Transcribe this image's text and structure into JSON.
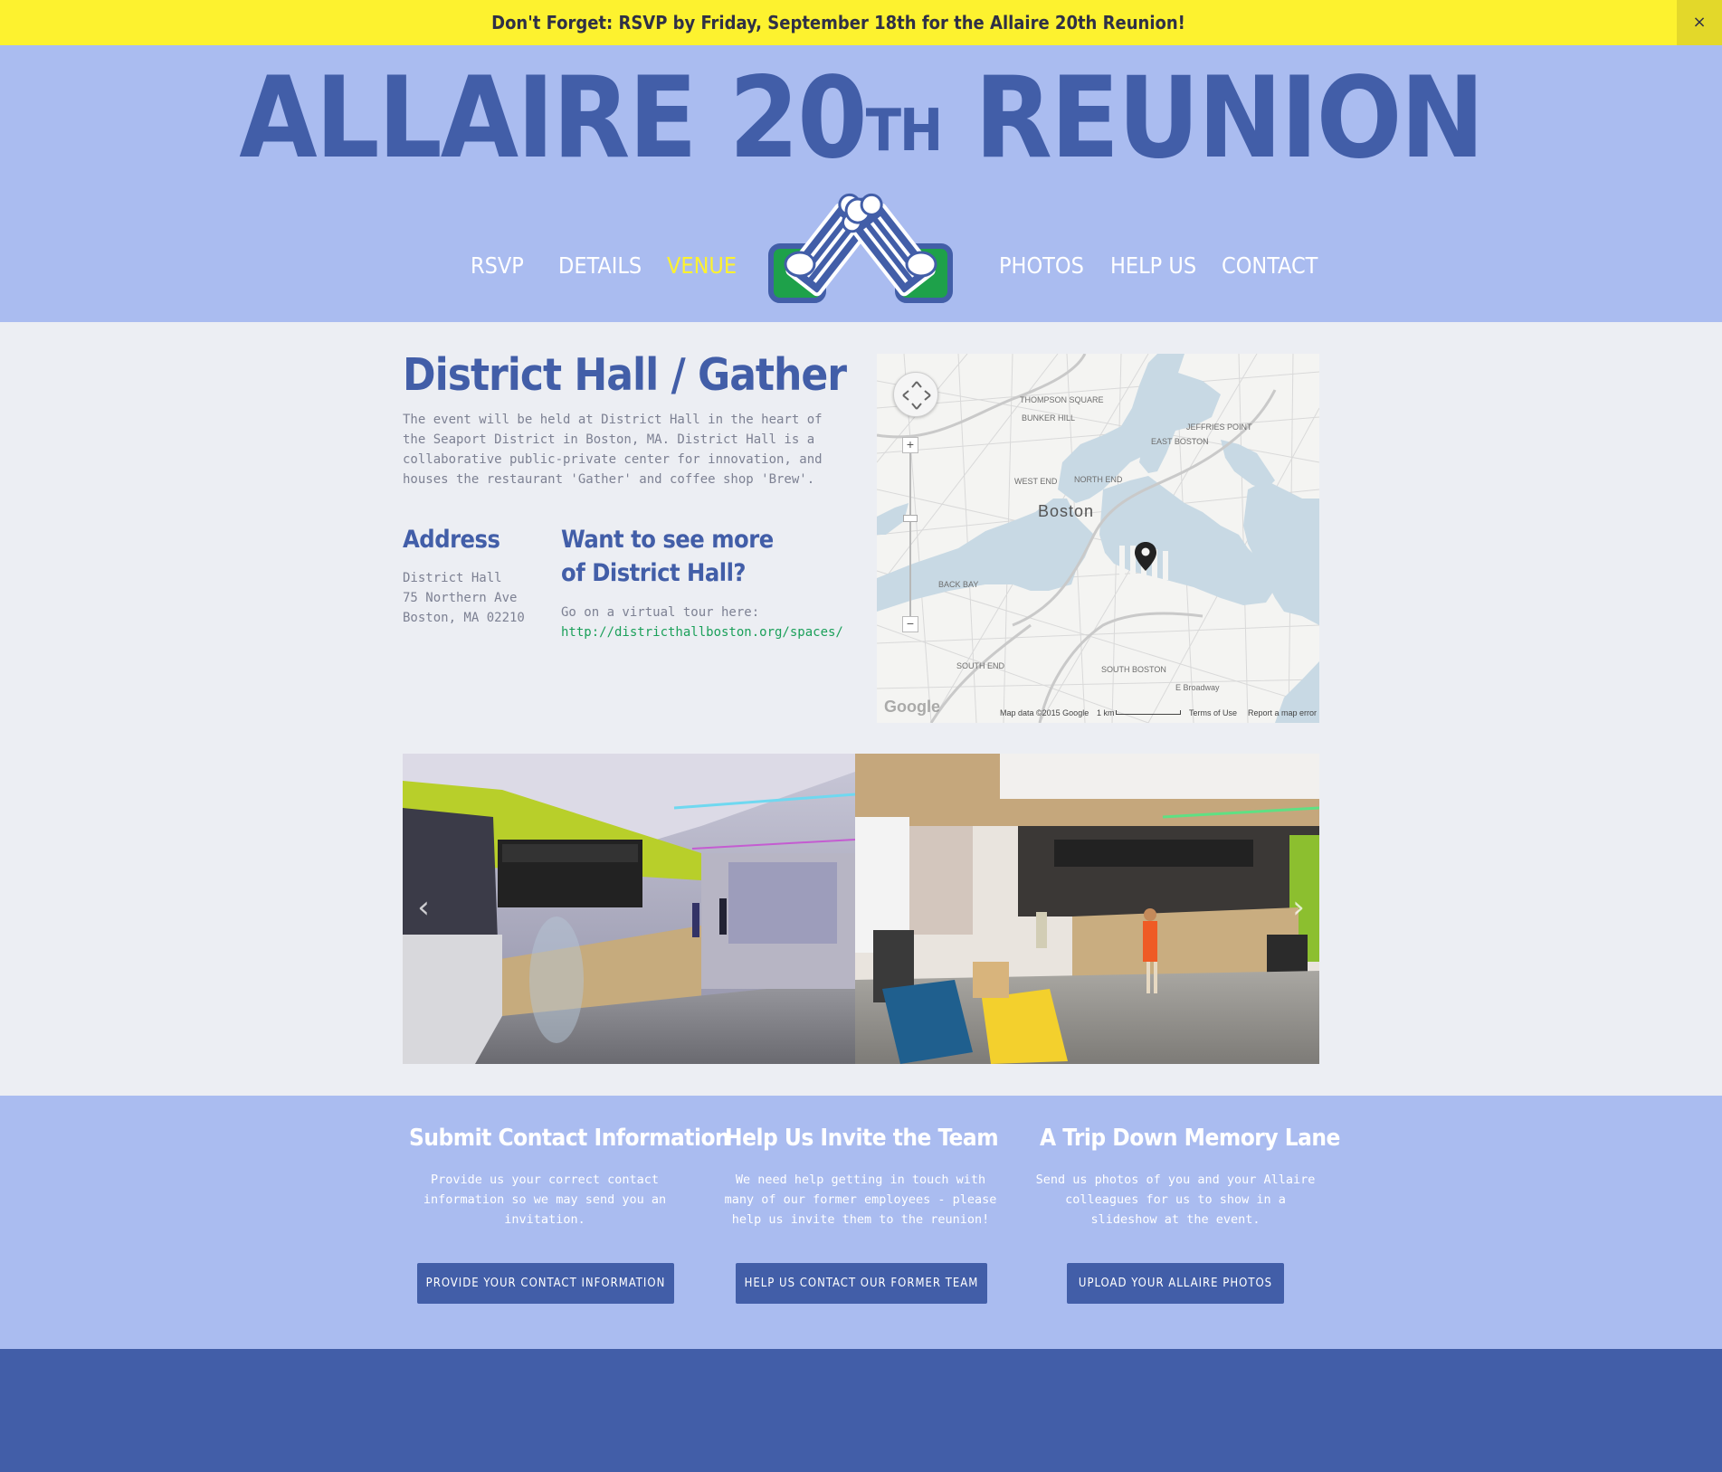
{
  "alert": {
    "text": "Don't Forget: RSVP by Friday, September 18th for the Allaire 20th Reunion!",
    "close_icon": "×"
  },
  "header": {
    "title_main": "ALLAIRE 20",
    "title_sup": "TH",
    "title_end": " REUNION",
    "logo_icon": "crossed-beer-mugs-logo"
  },
  "nav": {
    "items": [
      {
        "label": "RSVP"
      },
      {
        "label": "DETAILS"
      },
      {
        "label": "VENUE"
      },
      {
        "label": "PHOTOS"
      },
      {
        "label": "HELP US"
      },
      {
        "label": "CONTACT"
      }
    ],
    "active": "VENUE"
  },
  "venue": {
    "title": "District Hall / Gather",
    "description": "The event will be held at District Hall in the heart of the Seaport District in Boston, MA.  District Hall is a collaborative public-private center for innovation, and houses the restaurant 'Gather' and coffee shop 'Brew'.",
    "address": {
      "heading": "Address",
      "lines": [
        "District Hall",
        "75 Northern Ave",
        "Boston, MA 02210"
      ]
    },
    "tour": {
      "heading_line1": "Want to see more",
      "heading_line2": "of District Hall?",
      "text": "Go on a virtual tour here:",
      "link": "http://districthallboston.org/spaces/"
    }
  },
  "map": {
    "labels": {
      "thompson": "THOMPSON SQUARE",
      "bunker": "BUNKER HILL",
      "jeffries": "JEFFRIES POINT",
      "east_boston": "EAST BOSTON",
      "west_end": "WEST END",
      "north_end": "NORTH END",
      "boston": "Boston",
      "back_bay": "BACK BAY",
      "south_end": "SOUTH END",
      "south_boston": "SOUTH BOSTON",
      "e_broadway": "E Broadway"
    },
    "footer": {
      "data": "Map data ©2015 Google",
      "scale": "1 km",
      "terms": "Terms of Use",
      "report": "Report a map error"
    },
    "zoom_in": "+",
    "zoom_out": "−",
    "brand": "Google"
  },
  "carousel": {
    "prev_icon": "‹",
    "next_icon": "›"
  },
  "cta": [
    {
      "title": "Submit Contact Information",
      "text": "Provide us your correct contact information so we may send you an invitation.",
      "button": "PROVIDE YOUR CONTACT INFORMATION"
    },
    {
      "title": "Help Us Invite the Team",
      "text": "We need help getting in touch with many of our former employees - please help us invite them to the reunion!",
      "button": "HELP US CONTACT OUR FORMER TEAM"
    },
    {
      "title": "A Trip Down Memory Lane",
      "text": "Send us photos of you and your Allaire colleagues for us to show in a slideshow at the event.",
      "button": "UPLOAD YOUR ALLAIRE PHOTOS"
    }
  ],
  "colors": {
    "alert_bg": "#fdf22f",
    "header_bg": "#aabcf0",
    "brand_blue": "#425ea8",
    "active_nav": "#fdf22f",
    "link_green": "#1ba05a",
    "page_bg": "#eceef3"
  }
}
